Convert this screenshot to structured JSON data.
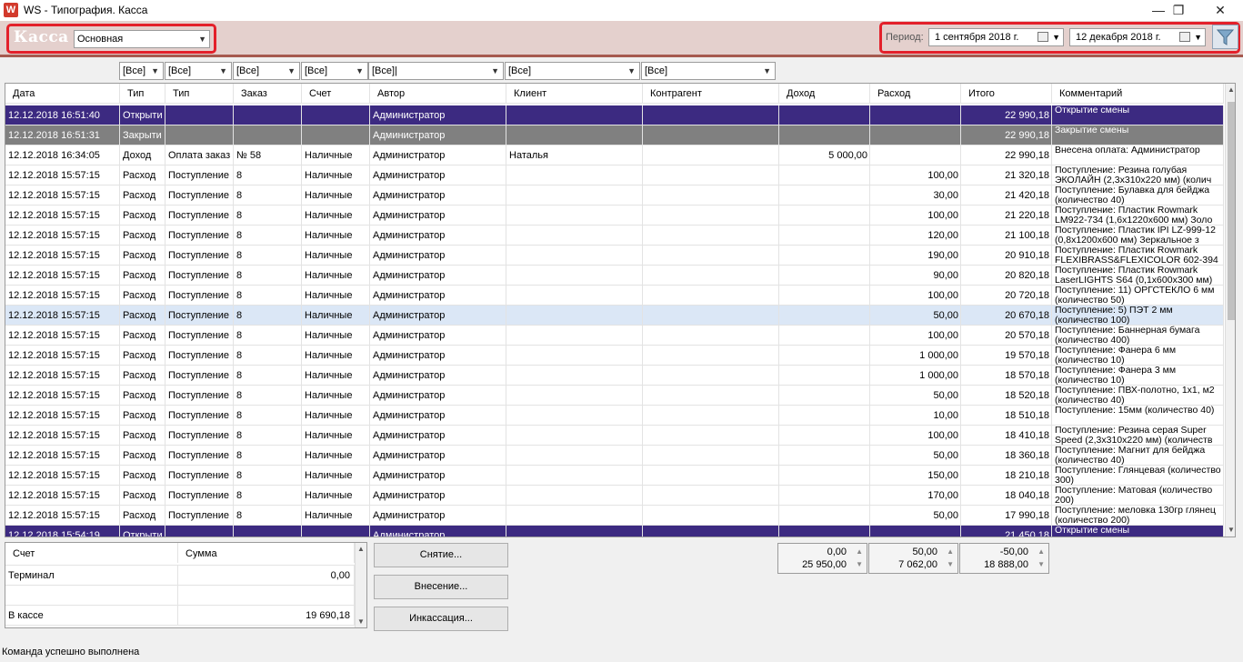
{
  "window": {
    "icon_letter": "W",
    "title": "WS - Типография. Касса",
    "minimize": "—",
    "maximize": "❐",
    "close": "✕"
  },
  "header": {
    "title": "Касса",
    "register": "Основная",
    "period_label": "Период:",
    "date_from": "1 сентября 2018 г.",
    "date_to": "12 декабря  2018 г."
  },
  "filters": [
    "[Все]",
    "[Все]",
    "[Все]",
    "[Все]",
    "[Все]|",
    "[Все]",
    "[Все]"
  ],
  "columns": [
    "Дата",
    "Тип",
    "Тип",
    "Заказ",
    "Счет",
    "Автор",
    "Клиент",
    "Контрагент",
    "Доход",
    "Расход",
    "Итого",
    "Комментарий"
  ],
  "rows": [
    {
      "date": "12.12.2018 16:51:40",
      "type": "Открыти",
      "subtype": "",
      "order": "",
      "account": "",
      "author": "Администратор",
      "client": "",
      "contractor": "",
      "income": "",
      "expense": "",
      "total": "22 990,18",
      "comment": "Открытие смены",
      "style": "sel"
    },
    {
      "date": "12.12.2018 16:51:31",
      "type": "Закрыти",
      "subtype": "",
      "order": "",
      "account": "",
      "author": "Администратор",
      "client": "",
      "contractor": "",
      "income": "",
      "expense": "",
      "total": "22 990,18",
      "comment": "Закрытие смены",
      "style": "gray"
    },
    {
      "date": "12.12.2018 16:34:05",
      "type": "Доход",
      "subtype": "Оплата заказ",
      "order": "№ 58",
      "account": "Наличные",
      "author": "Администратор",
      "client": "Наталья",
      "contractor": "",
      "income": "5 000,00",
      "expense": "",
      "total": "22 990,18",
      "comment": "Внесена оплата: Администратор",
      "style": ""
    },
    {
      "date": "12.12.2018 15:57:15",
      "type": "Расход",
      "subtype": "Поступление",
      "order": "8",
      "account": "Наличные",
      "author": "Администратор",
      "client": "",
      "contractor": "",
      "income": "",
      "expense": "100,00",
      "total": "21 320,18",
      "comment": "Поступление: Резина голубая ЭКОЛАЙН (2,3х310х220 мм)  (колич",
      "style": ""
    },
    {
      "date": "12.12.2018 15:57:15",
      "type": "Расход",
      "subtype": "Поступление",
      "order": "8",
      "account": "Наличные",
      "author": "Администратор",
      "client": "",
      "contractor": "",
      "income": "",
      "expense": "30,00",
      "total": "21 420,18",
      "comment": "Поступление: Булавка для бейджа (количество 40)",
      "style": ""
    },
    {
      "date": "12.12.2018 15:57:15",
      "type": "Расход",
      "subtype": "Поступление",
      "order": "8",
      "account": "Наличные",
      "author": "Администратор",
      "client": "",
      "contractor": "",
      "income": "",
      "expense": "100,00",
      "total": "21 220,18",
      "comment": "Поступление: Пластик Rowmark LM922-734 (1,6х1220х600 мм) Золо",
      "style": ""
    },
    {
      "date": "12.12.2018 15:57:15",
      "type": "Расход",
      "subtype": "Поступление",
      "order": "8",
      "account": "Наличные",
      "author": "Администратор",
      "client": "",
      "contractor": "",
      "income": "",
      "expense": "120,00",
      "total": "21 100,18",
      "comment": "Поступление: Пластик IPI LZ-999-12 (0,8х1200х600 мм) Зеркальное з",
      "style": ""
    },
    {
      "date": "12.12.2018 15:57:15",
      "type": "Расход",
      "subtype": "Поступление",
      "order": "8",
      "account": "Наличные",
      "author": "Администратор",
      "client": "",
      "contractor": "",
      "income": "",
      "expense": "190,00",
      "total": "20 910,18",
      "comment": "Поступление: Пластик Rowmark FLEXIBRASS&FLEXICOLOR 602-394 (",
      "style": ""
    },
    {
      "date": "12.12.2018 15:57:15",
      "type": "Расход",
      "subtype": "Поступление",
      "order": "8",
      "account": "Наличные",
      "author": "Администратор",
      "client": "",
      "contractor": "",
      "income": "",
      "expense": "90,00",
      "total": "20 820,18",
      "comment": "Поступление: Пластик Rowmark LaserLIGHTS S64 (0,1х600х300 мм)",
      "style": ""
    },
    {
      "date": "12.12.2018 15:57:15",
      "type": "Расход",
      "subtype": "Поступление",
      "order": "8",
      "account": "Наличные",
      "author": "Администратор",
      "client": "",
      "contractor": "",
      "income": "",
      "expense": "100,00",
      "total": "20 720,18",
      "comment": "Поступление: 11) ОРГСТЕКЛО 6 мм (количество 50)",
      "style": ""
    },
    {
      "date": "12.12.2018 15:57:15",
      "type": "Расход",
      "subtype": "Поступление",
      "order": "8",
      "account": "Наличные",
      "author": "Администратор",
      "client": "",
      "contractor": "",
      "income": "",
      "expense": "50,00",
      "total": "20 670,18",
      "comment": "Поступление: 5) ПЭТ 2 мм (количество 100)",
      "style": "hover"
    },
    {
      "date": "12.12.2018 15:57:15",
      "type": "Расход",
      "subtype": "Поступление",
      "order": "8",
      "account": "Наличные",
      "author": "Администратор",
      "client": "",
      "contractor": "",
      "income": "",
      "expense": "100,00",
      "total": "20 570,18",
      "comment": "Поступление: Баннерная бумага (количество 400)",
      "style": ""
    },
    {
      "date": "12.12.2018 15:57:15",
      "type": "Расход",
      "subtype": "Поступление",
      "order": "8",
      "account": "Наличные",
      "author": "Администратор",
      "client": "",
      "contractor": "",
      "income": "",
      "expense": "1 000,00",
      "total": "19 570,18",
      "comment": "Поступление: Фанера 6 мм (количество 10)",
      "style": ""
    },
    {
      "date": "12.12.2018 15:57:15",
      "type": "Расход",
      "subtype": "Поступление",
      "order": "8",
      "account": "Наличные",
      "author": "Администратор",
      "client": "",
      "contractor": "",
      "income": "",
      "expense": "1 000,00",
      "total": "18 570,18",
      "comment": "Поступление: Фанера 3 мм (количество 10)",
      "style": ""
    },
    {
      "date": "12.12.2018 15:57:15",
      "type": "Расход",
      "subtype": "Поступление",
      "order": "8",
      "account": "Наличные",
      "author": "Администратор",
      "client": "",
      "contractor": "",
      "income": "",
      "expense": "50,00",
      "total": "18 520,18",
      "comment": "Поступление: ПВХ-полотно, 1х1, м2 (количество 40)",
      "style": ""
    },
    {
      "date": "12.12.2018 15:57:15",
      "type": "Расход",
      "subtype": "Поступление",
      "order": "8",
      "account": "Наличные",
      "author": "Администратор",
      "client": "",
      "contractor": "",
      "income": "",
      "expense": "10,00",
      "total": "18 510,18",
      "comment": "Поступление: 15мм (количество 40)",
      "style": ""
    },
    {
      "date": "12.12.2018 15:57:15",
      "type": "Расход",
      "subtype": "Поступление",
      "order": "8",
      "account": "Наличные",
      "author": "Администратор",
      "client": "",
      "contractor": "",
      "income": "",
      "expense": "100,00",
      "total": "18 410,18",
      "comment": "Поступление: Резина серая Super Speed (2,3х310х220 мм) (количеств",
      "style": ""
    },
    {
      "date": "12.12.2018 15:57:15",
      "type": "Расход",
      "subtype": "Поступление",
      "order": "8",
      "account": "Наличные",
      "author": "Администратор",
      "client": "",
      "contractor": "",
      "income": "",
      "expense": "50,00",
      "total": "18 360,18",
      "comment": "Поступление: Магнит для бейджа (количество 40)",
      "style": ""
    },
    {
      "date": "12.12.2018 15:57:15",
      "type": "Расход",
      "subtype": "Поступление",
      "order": "8",
      "account": "Наличные",
      "author": "Администратор",
      "client": "",
      "contractor": "",
      "income": "",
      "expense": "150,00",
      "total": "18 210,18",
      "comment": "Поступление: Глянцевая (количество 300)",
      "style": ""
    },
    {
      "date": "12.12.2018 15:57:15",
      "type": "Расход",
      "subtype": "Поступление",
      "order": "8",
      "account": "Наличные",
      "author": "Администратор",
      "client": "",
      "contractor": "",
      "income": "",
      "expense": "170,00",
      "total": "18 040,18",
      "comment": "Поступление: Матовая (количество 200)",
      "style": ""
    },
    {
      "date": "12.12.2018 15:57:15",
      "type": "Расход",
      "subtype": "Поступление",
      "order": "8",
      "account": "Наличные",
      "author": "Администратор",
      "client": "",
      "contractor": "",
      "income": "",
      "expense": "50,00",
      "total": "17 990,18",
      "comment": "Поступление: меловка 130гр глянец (количество 200)",
      "style": ""
    },
    {
      "date": "12.12.2018 15:54:19",
      "type": "Открыти",
      "subtype": "",
      "order": "",
      "account": "",
      "author": "Администратор",
      "client": "",
      "contractor": "",
      "income": "",
      "expense": "",
      "total": "21 450,18",
      "comment": "Открытие смены",
      "style": "sel"
    }
  ],
  "summary": {
    "headers": [
      "Счет",
      "Сумма"
    ],
    "rows": [
      {
        "name": "Терминал",
        "value": "0,00"
      },
      {
        "name": "",
        "value": ""
      },
      {
        "name": "В кассе",
        "value": "19 690,18"
      }
    ]
  },
  "buttons": {
    "withdraw": "Снятие...",
    "deposit": "Внесение...",
    "collection": "Инкассация..."
  },
  "totals": [
    {
      "top": "0,00",
      "bottom": "25 950,00"
    },
    {
      "top": "50,00",
      "bottom": "7 062,00"
    },
    {
      "top": "-50,00",
      "bottom": "18 888,00"
    }
  ],
  "status": "Команда успешно выполнена",
  "colors": {
    "accent_header": "#e4d0cd",
    "selected_row": "#3c2a81",
    "highlight_box": "#e3202a"
  }
}
